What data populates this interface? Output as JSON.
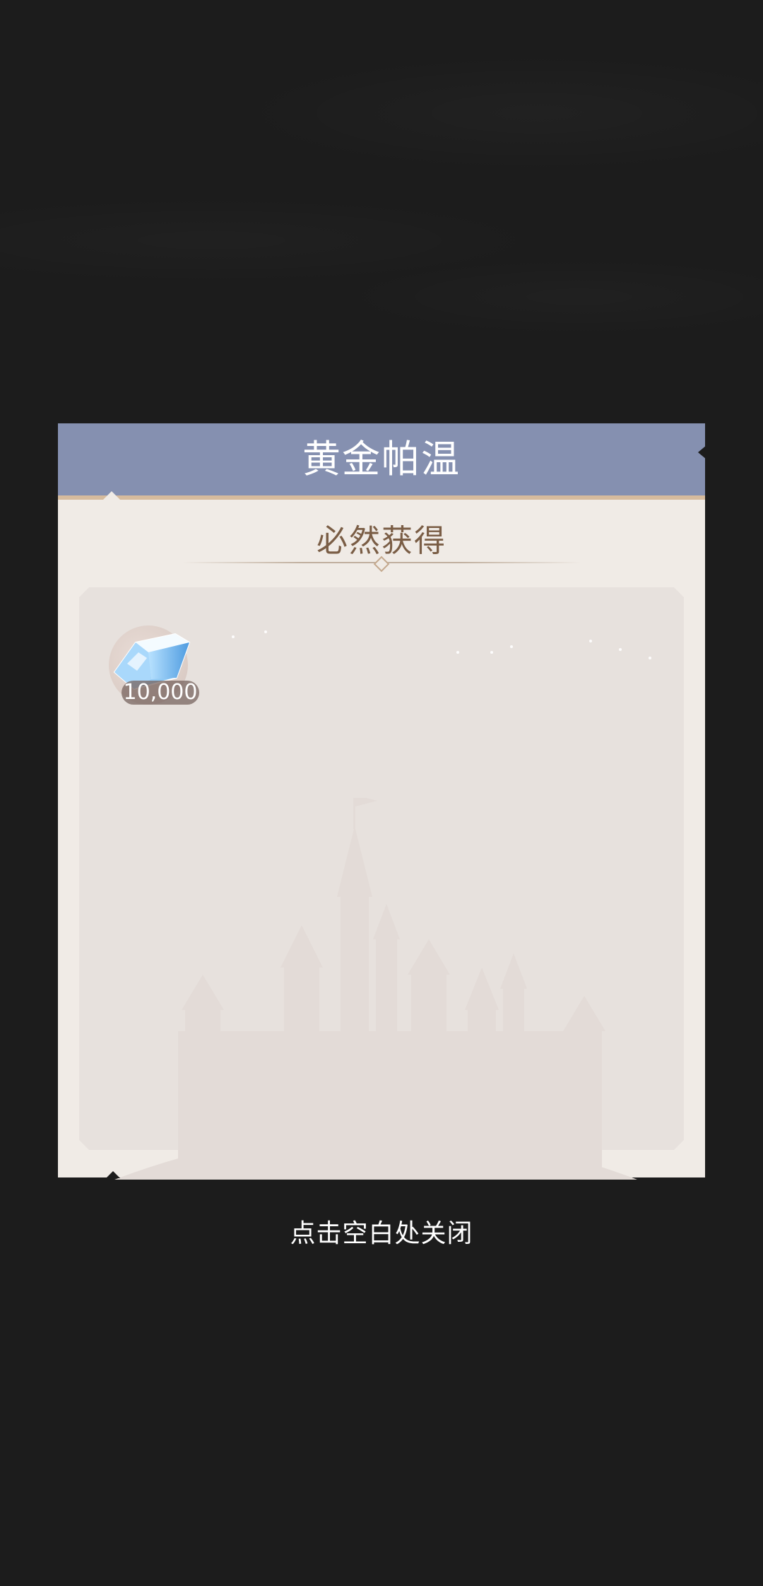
{
  "dialog": {
    "title": "黄金帕温",
    "section_title": "必然获得"
  },
  "rewards": [
    {
      "icon": "diamond-gem-icon",
      "quantity": "10,000"
    }
  ],
  "close_hint": "点击空白处关闭",
  "colors": {
    "backdrop": "#1c1c1c",
    "header": "#8590b0",
    "header_border": "#d6bb9d",
    "dialog_body": "#f0ebe6",
    "panel": "#e7e1dd",
    "section_title": "#7a5d45"
  }
}
